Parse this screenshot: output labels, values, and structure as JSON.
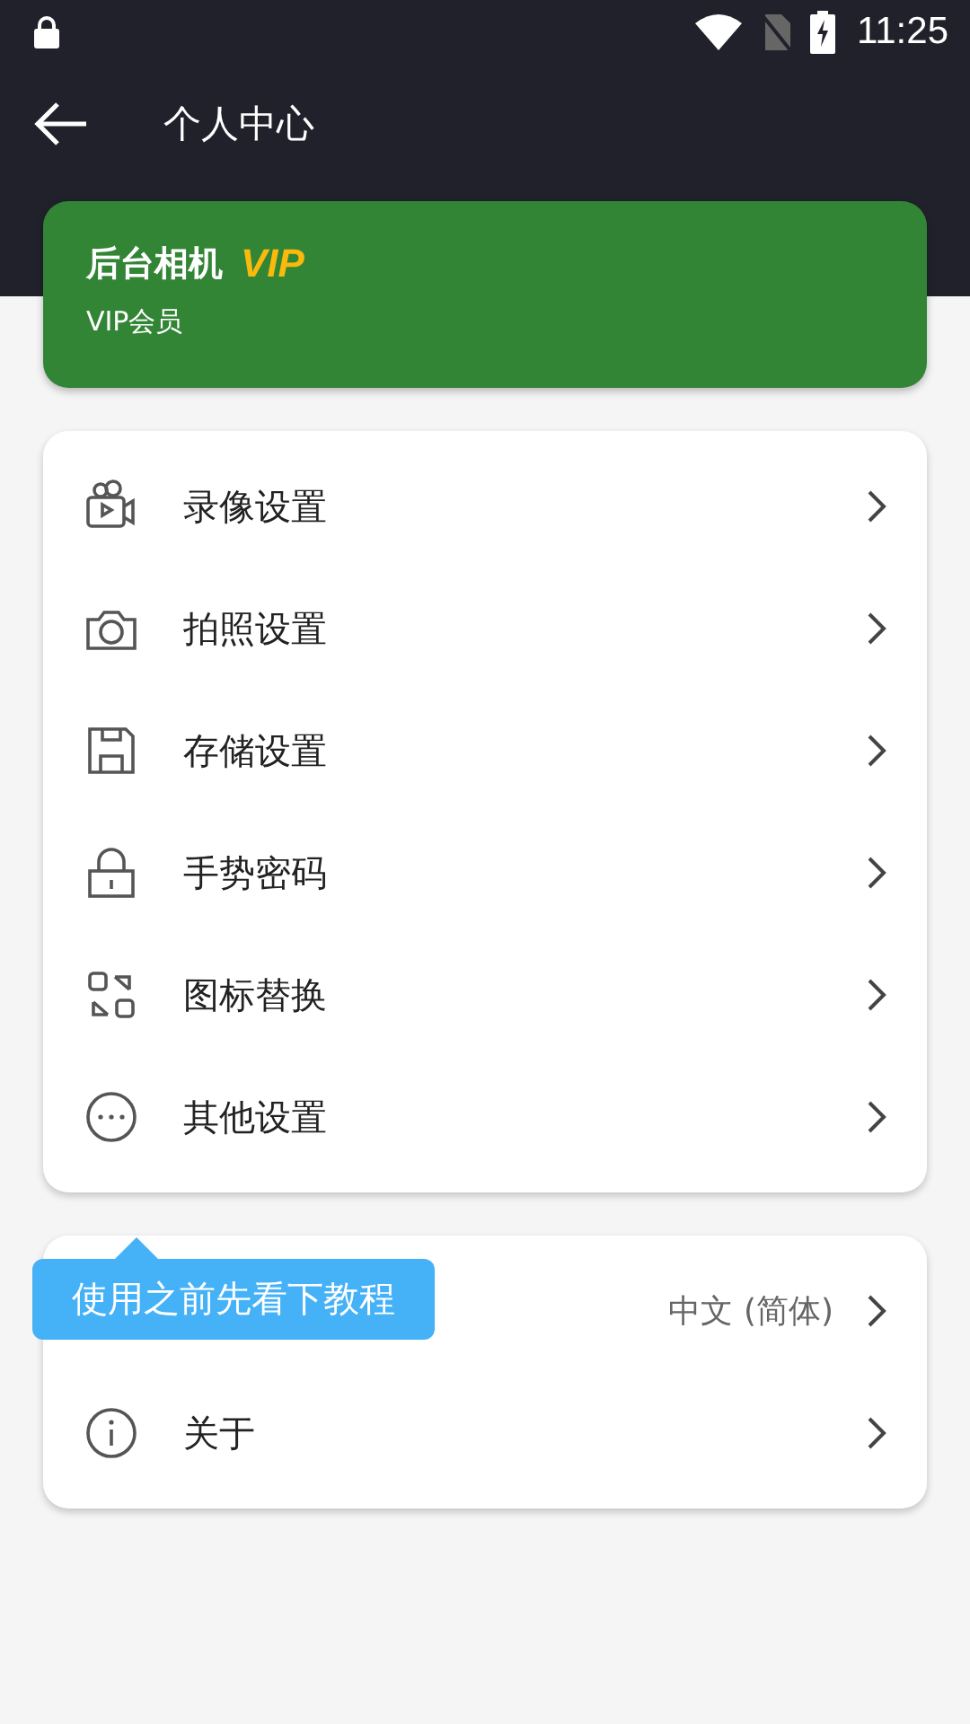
{
  "status_bar": {
    "time": "11:25"
  },
  "toolbar": {
    "title": "个人中心"
  },
  "vip_card": {
    "title": "后台相机",
    "badge": "VIP",
    "subtitle": "VIP会员"
  },
  "settings": [
    {
      "label": "录像设置"
    },
    {
      "label": "拍照设置"
    },
    {
      "label": "存储设置"
    },
    {
      "label": "手势密码"
    },
    {
      "label": "图标替换"
    },
    {
      "label": "其他设置"
    }
  ],
  "more": [
    {
      "value": "中文 (简体)"
    },
    {
      "label": "关于"
    }
  ],
  "tooltip": {
    "text": "使用之前先看下教程"
  }
}
